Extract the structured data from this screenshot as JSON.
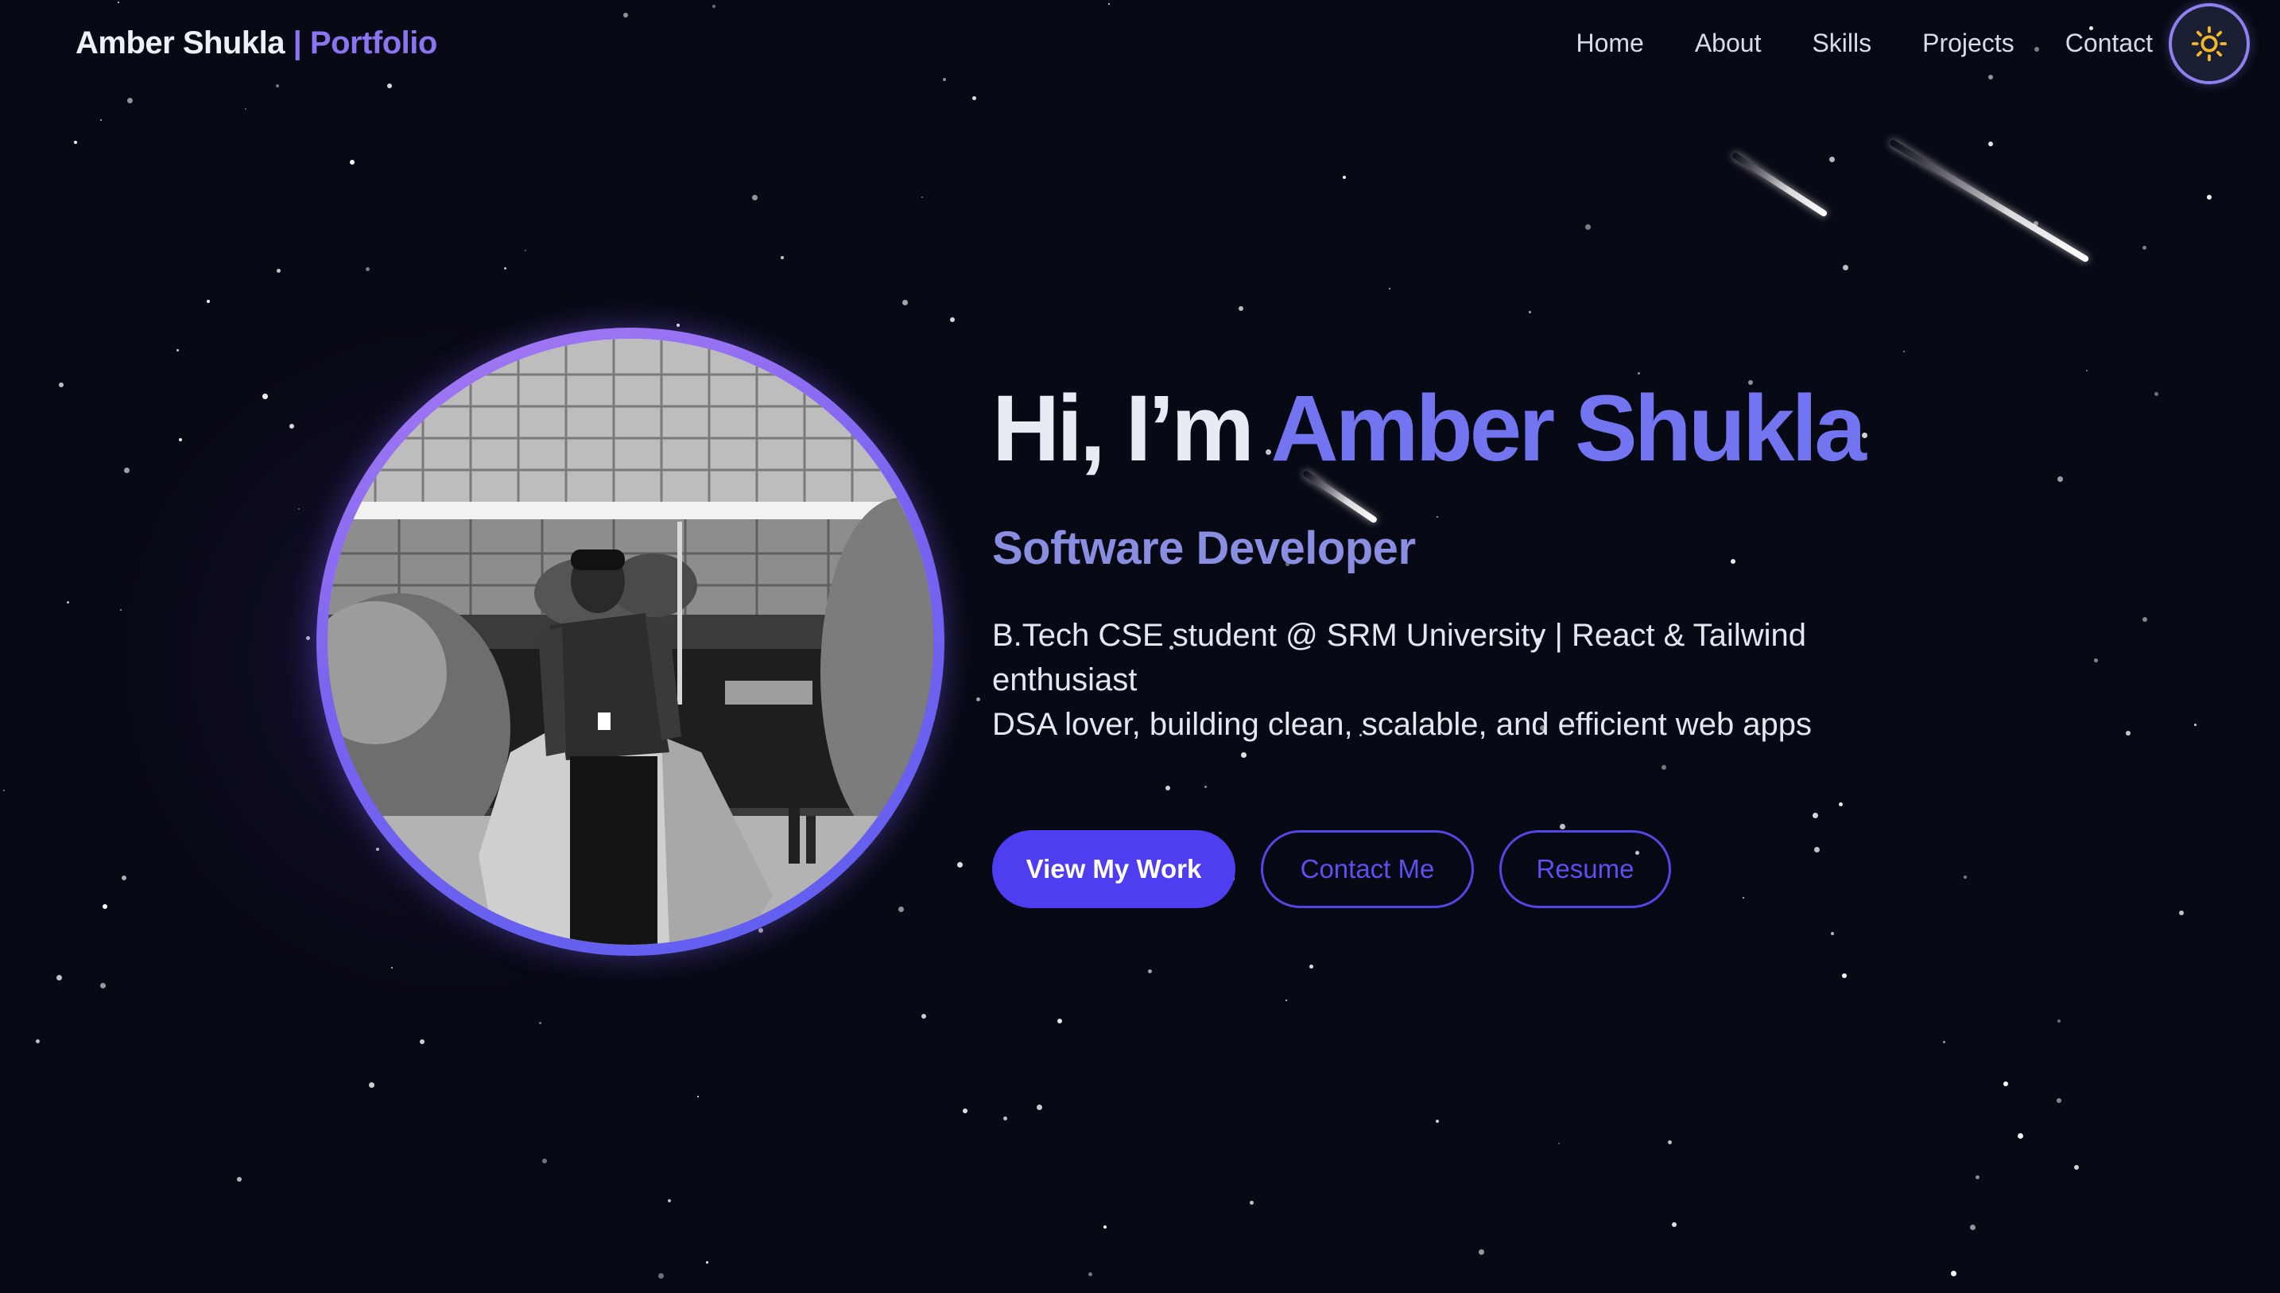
{
  "header": {
    "brand_name": "Amber Shukla",
    "brand_separator": "|",
    "brand_suffix": "Portfolio",
    "nav": [
      {
        "label": "Home"
      },
      {
        "label": "About"
      },
      {
        "label": "Skills"
      },
      {
        "label": "Projects"
      },
      {
        "label": "Contact"
      }
    ],
    "theme_toggle_icon": "sun-icon"
  },
  "hero": {
    "greeting": "Hi, I’m",
    "name": "Amber Shukla",
    "role": "Software Developer",
    "bio_line1": "B.Tech CSE student @ SRM University | React & Tailwind enthusiast",
    "bio_line2": "DSA lover, building clean, scalable, and efficient web apps",
    "avatar_icon": "profile-photo"
  },
  "buttons": {
    "view_work": "View My Work",
    "contact": "Contact Me",
    "resume": "Resume"
  },
  "colors": {
    "background": "#070914",
    "accent": "#7275ef",
    "primary_button": "#4f3df0",
    "sun": "#f5b928"
  }
}
